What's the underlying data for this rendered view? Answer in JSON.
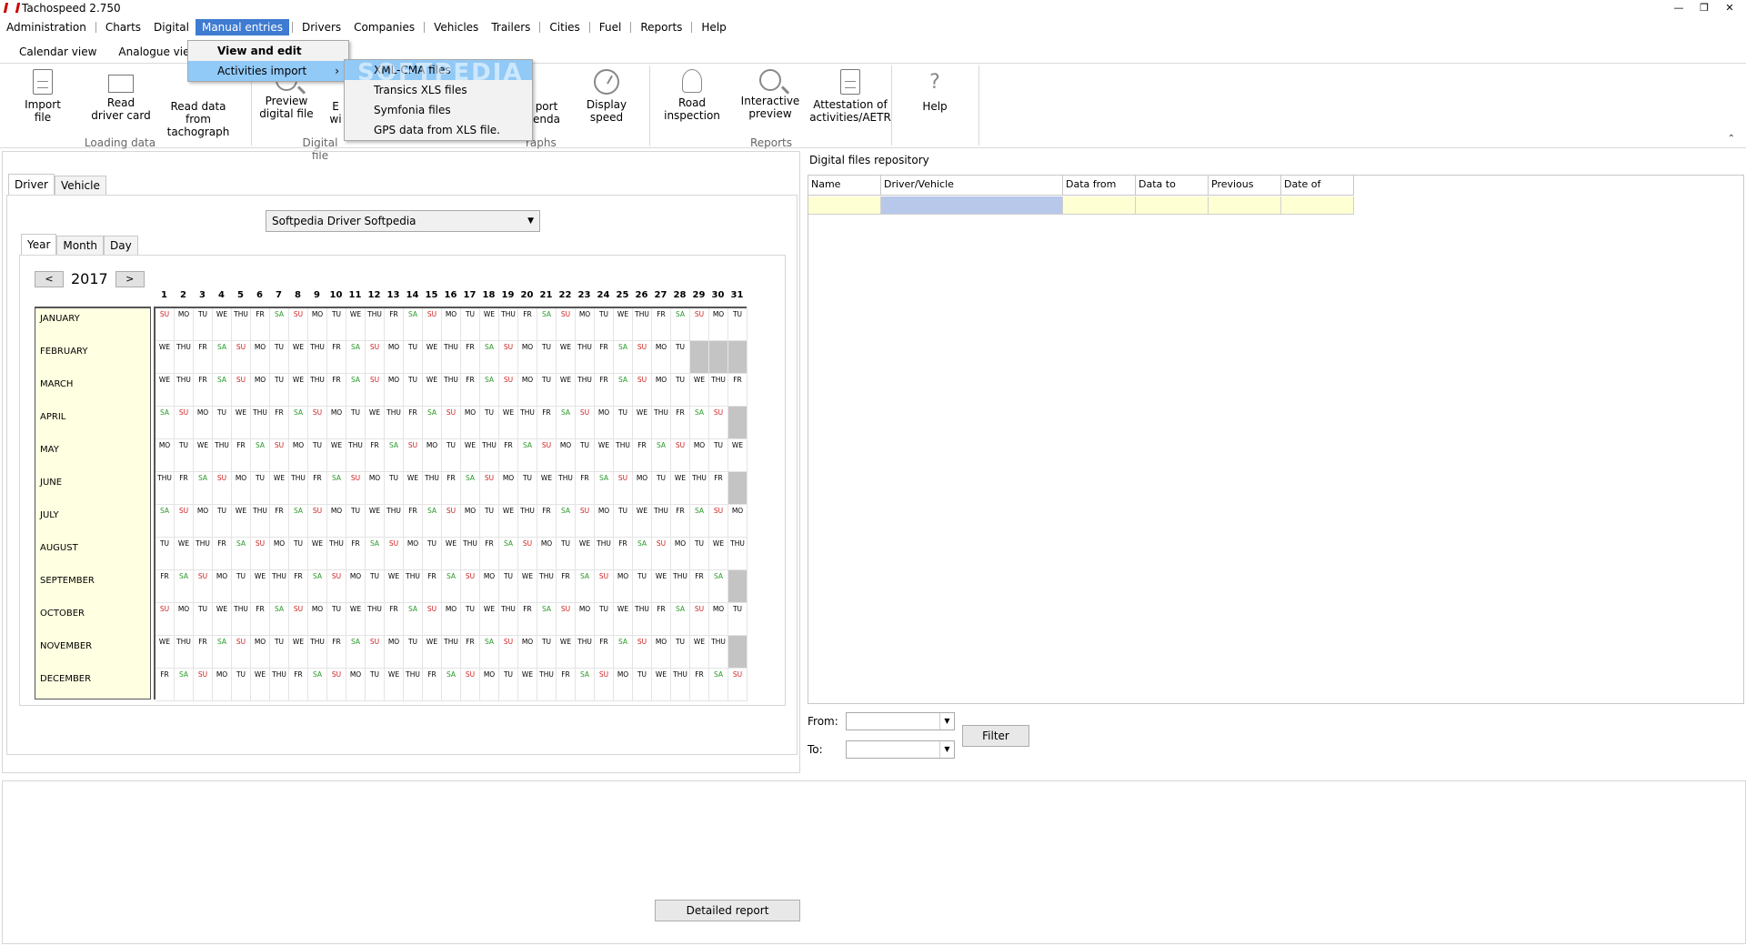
{
  "window": {
    "title": "Tachospeed 2.750"
  },
  "menu": [
    "Administration",
    "Charts",
    "Digital",
    "Manual entries",
    "Drivers",
    "Companies",
    "Vehicles",
    "Trailers",
    "Cities",
    "Fuel",
    "Reports",
    "Help"
  ],
  "ribbon_tabs": [
    "Calendar view",
    "Analogue view"
  ],
  "ribbon": {
    "import_file": "Import\nfile",
    "read_driver_card": "Read\ndriver card",
    "read_tachograph": "Read data from\ntachograph",
    "preview_digital": "Preview\ndigital file",
    "edit_partial": "E\nwi",
    "export_calendar_partial": "port\nendar",
    "display_speed": "Display\nspeed",
    "road_inspection": "Road\ninspection",
    "interactive_preview": "Interactive\npreview",
    "attestation": "Attestation of\nactivities/AETR",
    "help": "Help",
    "group_loading": "Loading data",
    "group_digital": "Digital file",
    "group_graphs_partial": "raphs",
    "group_reports": "Reports"
  },
  "manual_menu": {
    "view_edit": "View and edit",
    "activities_import": "Activities import"
  },
  "import_menu": {
    "watermark": "SOFTPEDIA",
    "items": [
      "XML-CMA files",
      "Transics XLS files",
      "Symfonia files",
      "GPS data from XLS file."
    ]
  },
  "left": {
    "tabs": [
      "Driver",
      "Vehicle"
    ],
    "driver": "Softpedia Driver Softpedia",
    "period_tabs": [
      "Year",
      "Month",
      "Day"
    ],
    "year": "2017",
    "prev": "<",
    "next": ">",
    "months": [
      "JANUARY",
      "FEBRUARY",
      "MARCH",
      "APRIL",
      "MAY",
      "JUNE",
      "JULY",
      "AUGUST",
      "SEPTEMBER",
      "OCTOBER",
      "NOVEMBER",
      "DECEMBER"
    ],
    "detailed_report": "Detailed report"
  },
  "calendar": {
    "year": 2017,
    "day_labels": [
      "MO",
      "TU",
      "WE",
      "THU",
      "FR",
      "SA",
      "SU"
    ],
    "weekend_color": "#2a9a2a",
    "sunday_color": "#d02020"
  },
  "repo": {
    "title": "Digital files repository",
    "columns": [
      "Name",
      "Driver/Vehicle",
      "Data from",
      "Data to",
      "Previous",
      "Date of import"
    ]
  },
  "filter": {
    "from_label": "From:",
    "to_label": "To:",
    "button": "Filter"
  }
}
